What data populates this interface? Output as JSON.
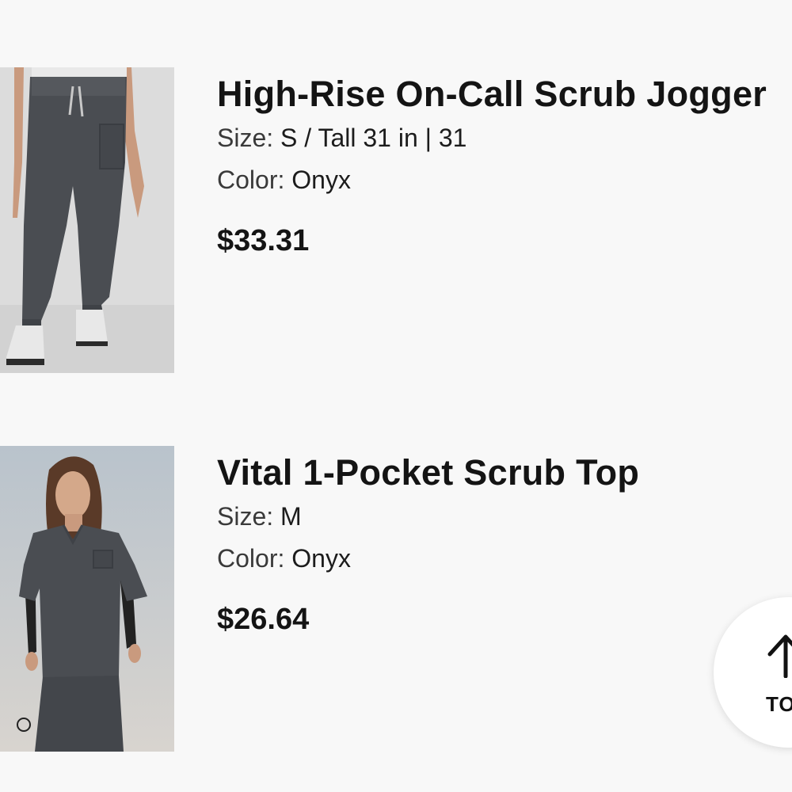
{
  "cart_items": [
    {
      "image_alt": "High-Rise On-Call Scrub Jogger in Onyx",
      "name": "High-Rise On-Call Scrub Jogger",
      "size_label": "Size:",
      "size_value": "S / Tall 31 in | 31",
      "color_label": "Color:",
      "color_value": "Onyx",
      "price": "$33.31"
    },
    {
      "image_alt": "Vital 1-Pocket Scrub Top in Onyx",
      "name": "Vital 1-Pocket Scrub Top",
      "size_label": "Size:",
      "size_value": "M",
      "color_label": "Color:",
      "color_value": "Onyx",
      "price": "$26.64"
    }
  ],
  "back_to_top": {
    "label": "TOP",
    "icon": "arrow-up-icon"
  },
  "colors": {
    "background": "#f8f8f8",
    "text": "#141414",
    "product_onyx": "#4a4d52"
  }
}
